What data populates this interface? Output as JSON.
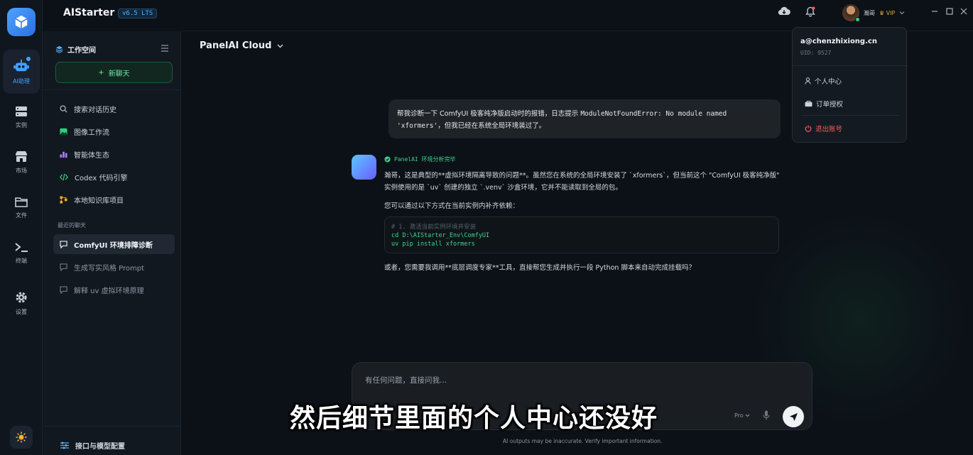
{
  "app": {
    "title": "AIStarter",
    "version": "v6.5 LTS"
  },
  "rail": {
    "items": [
      {
        "label": "AI助理",
        "icon": "robot-icon",
        "active": true
      },
      {
        "label": "实例",
        "icon": "server-icon"
      },
      {
        "label": "市场",
        "icon": "store-icon"
      },
      {
        "label": "文件",
        "icon": "folder-icon"
      },
      {
        "label": "终端",
        "icon": "terminal-icon"
      },
      {
        "label": "设置",
        "icon": "gear-icon"
      }
    ],
    "theme_icon": "sun-icon"
  },
  "sidebar": {
    "workspace_label": "工作空间",
    "new_chat_label": "新聊天",
    "nav": [
      {
        "label": "搜索对话历史",
        "icon": "search-icon"
      },
      {
        "label": "图像工作流",
        "icon": "image-icon"
      },
      {
        "label": "智能体生态",
        "icon": "agents-icon"
      },
      {
        "label": "Codex 代码引擎",
        "icon": "code-icon"
      },
      {
        "label": "本地知识库项目",
        "icon": "knowledge-icon"
      }
    ],
    "recent_label": "最近的聊天",
    "recent": [
      {
        "label": "ComfyUI 环境排障诊断",
        "active": true
      },
      {
        "label": "生成写实风格 Prompt",
        "active": false
      },
      {
        "label": "解释 uv 虚拟环境原理",
        "active": false
      }
    ],
    "bottom_label": "接口与模型配置"
  },
  "header": {
    "model_name": "PanelAI Cloud"
  },
  "user": {
    "name": "瀚哥",
    "badge": "VIP",
    "email": "a@chenzhixiong.cn",
    "uid": "UID: 9527"
  },
  "user_menu": {
    "items": [
      {
        "label": "个人中心",
        "icon": "user-icon"
      },
      {
        "label": "订单授权",
        "icon": "order-icon"
      }
    ],
    "logout_label": "退出账号"
  },
  "conversation": {
    "user_message_part1": "帮我诊断一下 ComfyUI 极客纯净版启动时的报错，日志提示 ",
    "user_message_code1": "ModuleNotFoundError: No module named",
    "user_message_code2": "'xformers'",
    "user_message_part2": "，但我已经在系统全局环境装过了。",
    "ai_status": "PanelAI 环境分析完毕",
    "ai_paragraph1": "瀚哥，这是典型的**虚拟环境隔离导致的问题**。虽然您在系统的全局环境安装了 `xformers`，但当前这个 \"ComfyUI 极客纯净版\" 实例使用的是 `uv` 创建的独立 `.venv` 沙盒环境，它并不能读取到全局的包。",
    "ai_paragraph2": "您可以通过以下方式在当前实例内补齐依赖：",
    "code_lines": [
      "# 1. 激活当前实例环境并安装",
      "cd D:\\AIStarter_Env\\ComfyUI",
      "uv pip install xformers"
    ],
    "ai_paragraph3": "或者，您需要我调用**底层调度专家**工具，直接帮您生成并执行一段 Python 脚本来自动完成挂载吗？"
  },
  "composer": {
    "placeholder": "有任何问题，直接问我...",
    "mode": "Pro",
    "disclaimer": "AI outputs may be inaccurate. Verify important information."
  },
  "subtitle": "然后细节里面的个人中心还没好",
  "colors": {
    "accent": "#3fa2ff",
    "success": "#45d08a",
    "danger": "#ff5a5a",
    "vip": "#e0a53a"
  }
}
